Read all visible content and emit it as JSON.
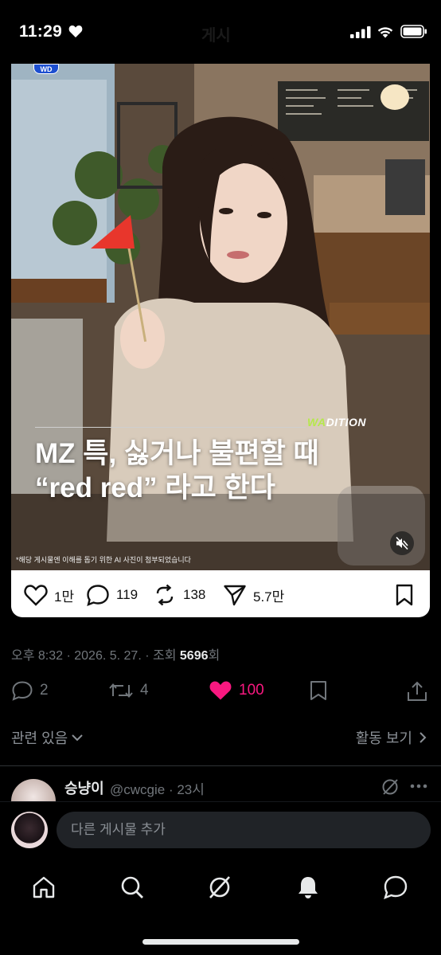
{
  "status_bar": {
    "time": "11:29",
    "title": "게시"
  },
  "media": {
    "logo": "WD",
    "brand_prefix": "WA",
    "brand_suffix": "DITION",
    "headline_line1": "MZ 특, 싫거나 불편할 때",
    "headline_line2": "“red red” 라고 한다",
    "disclaimer": "*해당 게시물엔 이해를 돕기 위한 AI 사진이 첨부되었습니다",
    "muted": true
  },
  "card_actions": {
    "likes": "1만",
    "comments": "119",
    "reposts": "138",
    "shares": "5.7만"
  },
  "meta": {
    "time": "오후 8:32",
    "date": "2026. 5. 27.",
    "views_label": "조회",
    "views": "5696",
    "views_suffix": "회"
  },
  "tweet_actions": {
    "replies": "2",
    "reposts": "4",
    "likes": "100"
  },
  "related_label": "관련 있음",
  "activity_label": "활동 보기",
  "reply": {
    "name": "승냥이",
    "handle": "@cwcgie · 23시"
  },
  "composer": {
    "placeholder": "다른 게시물 추가"
  },
  "colors": {
    "like": "#f91880",
    "brand_green": "#b6e84c",
    "muted_text": "#71767b"
  },
  "icons": {
    "nav": [
      "home-icon",
      "search-icon",
      "grok-icon",
      "notifications-icon",
      "messages-icon"
    ]
  }
}
